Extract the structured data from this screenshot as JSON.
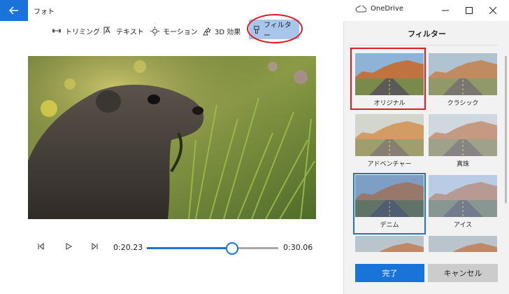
{
  "window": {
    "app_title": "フォト",
    "onedrive_label": "OneDrive"
  },
  "toolbar": {
    "items": [
      {
        "label": "トリミング",
        "icon": "trim-icon"
      },
      {
        "label": "テキスト",
        "icon": "text-icon"
      },
      {
        "label": "モーション",
        "icon": "motion-icon"
      },
      {
        "label": "3D 効果",
        "icon": "3d-effects-icon"
      },
      {
        "label": "フィルター",
        "icon": "filter-icon",
        "active": true
      }
    ]
  },
  "player": {
    "current_time": "0:20.23",
    "total_time": "0:30.06",
    "progress": 0.65
  },
  "filter_panel": {
    "title": "フィルター",
    "filters": [
      {
        "label": "オリジナル",
        "style": "original"
      },
      {
        "label": "クラシック",
        "style": "classic"
      },
      {
        "label": "アドベンチャー",
        "style": "adventure"
      },
      {
        "label": "真珠",
        "style": "pearl"
      },
      {
        "label": "デニム",
        "style": "denim",
        "selected": true
      },
      {
        "label": "アイス",
        "style": "ice"
      },
      {
        "label": "",
        "style": "partial"
      },
      {
        "label": "",
        "style": "partial"
      }
    ],
    "done_label": "完了",
    "cancel_label": "キャンセル"
  },
  "colors": {
    "accent": "#1a73d9",
    "highlight": "#e21b22",
    "active_tool_bg": "#a7c6ea"
  }
}
